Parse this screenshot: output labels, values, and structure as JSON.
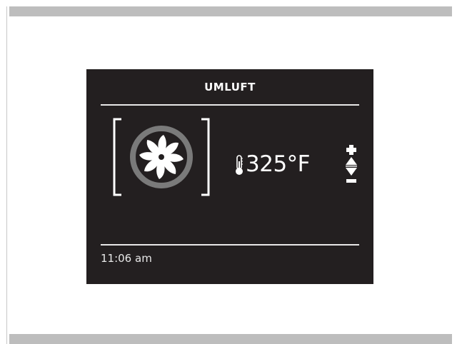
{
  "display": {
    "mode_title": "UMLUFT",
    "temperature": "325°F",
    "time": "11:06 am",
    "mode_icon": "convection-fan-icon",
    "temperature_icon": "thermometer-icon",
    "adjust_icons": [
      "plus-icon",
      "arrow-up-icon",
      "arrow-down-icon",
      "minus-icon"
    ]
  },
  "colors": {
    "screen_background": "#231f20",
    "foreground": "#ffffff",
    "fan_ring": "#7a7a7a",
    "page_rule": "#bdbdbd"
  }
}
